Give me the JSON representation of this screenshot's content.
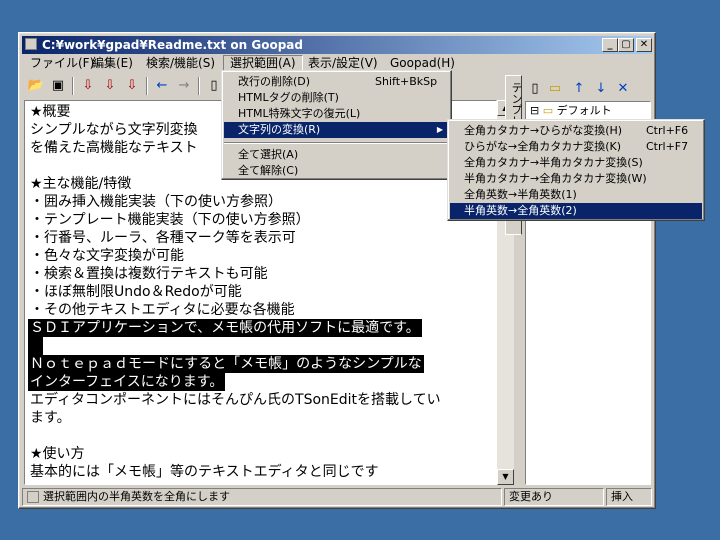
{
  "window": {
    "title": "C:¥work¥gpad¥Readme.txt on Goopad",
    "min": "_",
    "max": "▢",
    "close": "✕"
  },
  "menubar": [
    "ファイル(F)",
    "編集(E)",
    "検索/機能(S)",
    "選択範囲(A)",
    "表示/設定(V)",
    "Goopad(H)"
  ],
  "editor": {
    "lines": [
      "★概要",
      "シンプルながら文字列変換",
      "を備えた高機能なテキスト",
      "",
      "★主な機能/特徴",
      "・囲み挿入機能実装（下の使い方参照）",
      "・テンプレート機能実装（下の使い方参照）",
      "・行番号、ルーラ、各種マーク等を表示可",
      "・色々な文字変換が可能",
      "・検索＆置換は複数行テキストも可能",
      "・ほぼ無制限Undo＆Redoが可能",
      "・その他テキストエディタに必要な各機能",
      "ＳＤＩアプリケーションで、メモ帳の代用ソフトに最適です。",
      "",
      "Ｎｏｔｅｐａｄモードにすると「メモ帳」のようなシンプルな",
      "インターフェイスになります。",
      "エディタコンポーネントにはそんぴん氏のTSonEditを搭載してい",
      "ます。",
      "",
      "★使い方",
      "基本的には「メモ帳」等のテキストエディタと同じです"
    ]
  },
  "side": {
    "tab_label": "テンプレート",
    "tree_item": "デフォルト",
    "tree_expander": "⊟"
  },
  "menu_select": {
    "items": [
      {
        "label": "改行の削除(D)",
        "shortcut": "Shift+BkSp"
      },
      {
        "label": "HTMLタグの削除(T)",
        "shortcut": ""
      },
      {
        "label": "HTML特殊文字の復元(L)",
        "shortcut": ""
      },
      {
        "label": "文字列の変換(R)",
        "shortcut": ""
      },
      {
        "label": "全て選択(A)",
        "shortcut": ""
      },
      {
        "label": "全て解除(C)",
        "shortcut": ""
      }
    ]
  },
  "submenu": {
    "items": [
      {
        "label": "全角カタカナ→ひらがな変換(H)",
        "shortcut": "Ctrl+F6"
      },
      {
        "label": "ひらがな→全角カタカナ変換(K)",
        "shortcut": "Ctrl+F7"
      },
      {
        "label": "全角カタカナ→半角カタカナ変換(S)",
        "shortcut": ""
      },
      {
        "label": "半角カタカナ→全角カタカナ変換(W)",
        "shortcut": ""
      },
      {
        "label": "全角英数→半角英数(1)",
        "shortcut": ""
      },
      {
        "label": "半角英数→全角英数(2)",
        "shortcut": ""
      }
    ]
  },
  "status": {
    "message": "選択範囲内の半角英数を全角にします",
    "modified": "変更あり",
    "mode": "挿入"
  }
}
